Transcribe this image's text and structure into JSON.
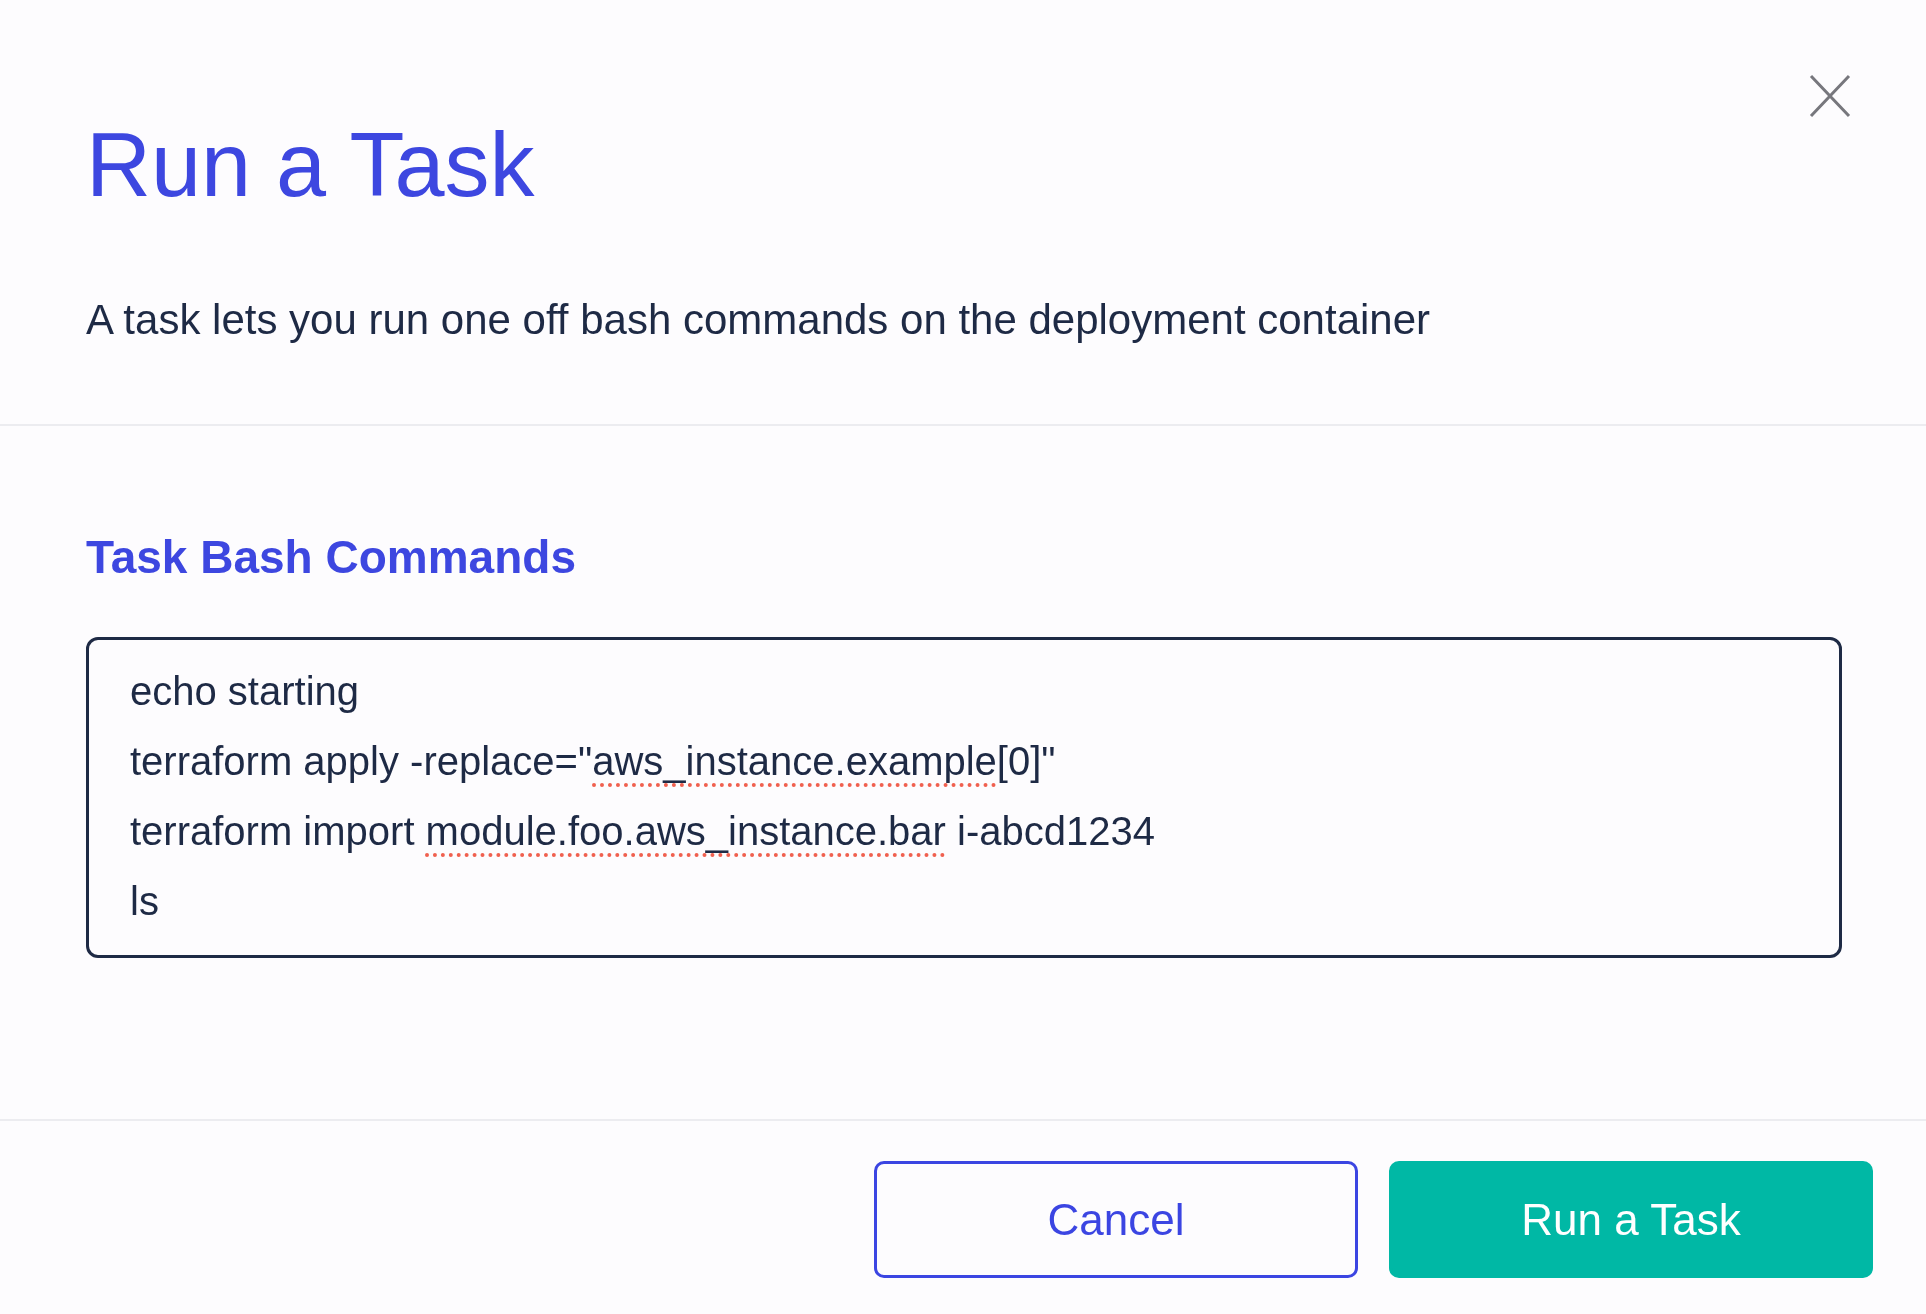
{
  "dialog": {
    "title": "Run a Task",
    "description": "A task lets you run one off bash commands on the deployment container"
  },
  "commands": {
    "label": "Task Bash Commands",
    "lines": [
      {
        "segments": [
          {
            "text": "echo starting",
            "misspelled": false
          }
        ]
      },
      {
        "segments": [
          {
            "text": "terraform apply -replace=\"",
            "misspelled": false
          },
          {
            "text": "aws_instance.example",
            "misspelled": true
          },
          {
            "text": "[0]\"",
            "misspelled": false
          }
        ]
      },
      {
        "segments": [
          {
            "text": "terraform import ",
            "misspelled": false
          },
          {
            "text": "module.foo.aws_instance.bar",
            "misspelled": true
          },
          {
            "text": " i-abcd1234",
            "misspelled": false
          }
        ]
      },
      {
        "segments": [
          {
            "text": "ls",
            "misspelled": false
          }
        ]
      }
    ]
  },
  "buttons": [
    {
      "label": "Cancel",
      "kind": "secondary"
    },
    {
      "label": "Run a Task",
      "kind": "primary"
    }
  ]
}
